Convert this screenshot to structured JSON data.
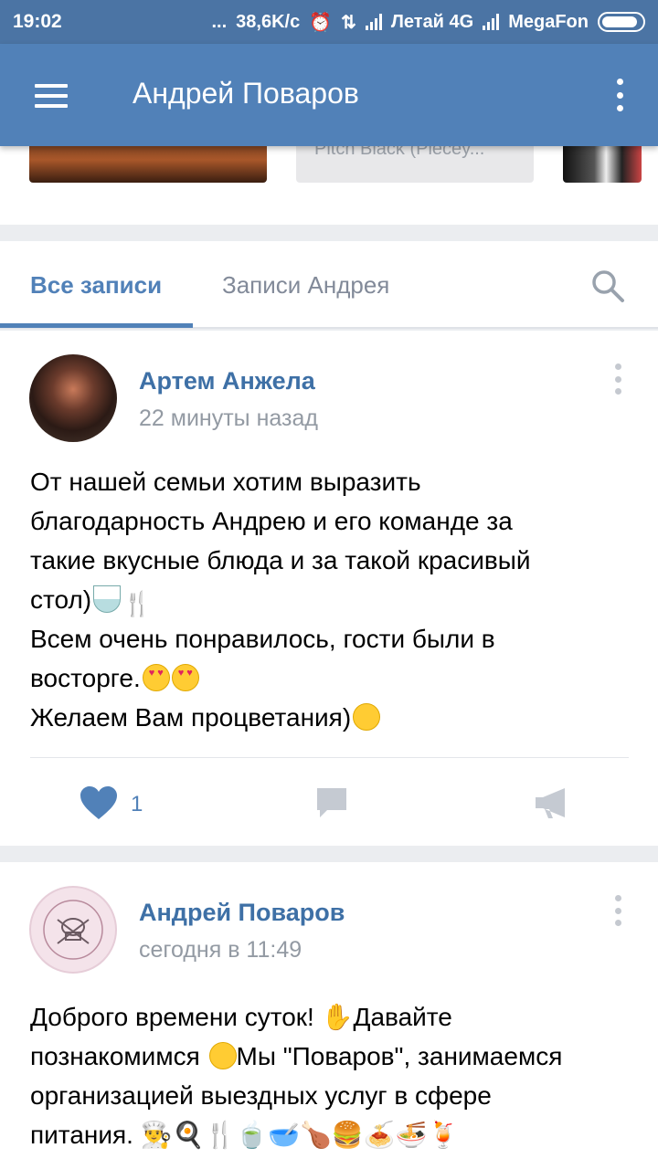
{
  "status_bar": {
    "time": "19:02",
    "dots": "...",
    "speed": "38,6K/с",
    "carrier1": "Летай 4G",
    "carrier2": "MegaFon"
  },
  "app_bar": {
    "title": "Андрей Поваров"
  },
  "media_strip": {
    "audio_label": "Pitch Black (Piecey..."
  },
  "tabs": {
    "all": "Все записи",
    "andrey": "Записи Андрея"
  },
  "post1": {
    "author": "Артем Анжела",
    "time": "22 минуты назад",
    "lines": [
      "От нашей семьи хотим выразить",
      "благодарность Андрею и его команде за",
      "такие вкусные блюда и за такой красивый",
      "стол)",
      "Всем очень понравилось, гости были в",
      "восторге.",
      "Желаем Вам процветания)"
    ],
    "likes": "1"
  },
  "post2": {
    "author": "Андрей Поваров",
    "time": "сегодня в 11:49",
    "lines": [
      "Доброго времени суток! ",
      "Давайте",
      "познакомимся ",
      "Мы \"Поваров\", занимаемся",
      "организацией выездных услуг в сфере",
      "питания. "
    ]
  },
  "colors": {
    "header": "#5181b8",
    "status": "#4b74a4",
    "link": "#3e70a6",
    "muted": "#939aa3"
  }
}
